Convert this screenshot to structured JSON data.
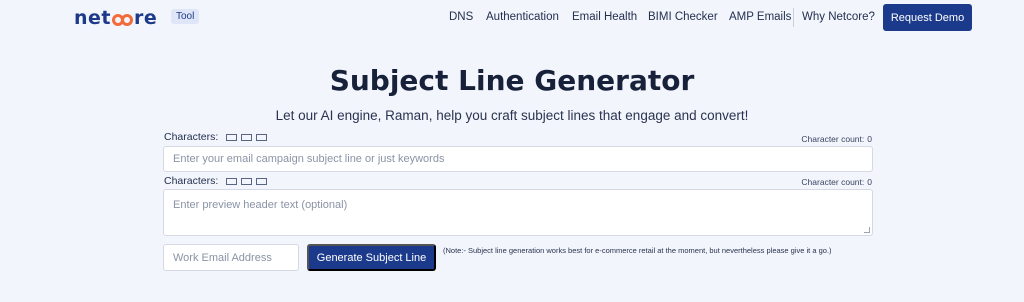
{
  "header": {
    "logo": {
      "prefix": "net",
      "suffix": "re"
    },
    "badge": "Tool",
    "nav": [
      "DNS",
      "Authentication",
      "Email Health",
      "BIMI Checker",
      "AMP Emails",
      "Why Netcore?"
    ],
    "cta": "Request Demo"
  },
  "main": {
    "title": "Subject Line Generator",
    "subtitle": "Let our AI engine, Raman, help you craft subject lines that engage and convert!",
    "subject": {
      "characters_label": "Characters:",
      "count_label": "Character count:",
      "count_value": "0",
      "placeholder": "Enter your email campaign subject line or just keywords",
      "value": ""
    },
    "preview": {
      "characters_label": "Characters:",
      "count_label": "Character count:",
      "count_value": "0",
      "placeholder": "Enter preview header text (optional)",
      "value": ""
    },
    "email_placeholder": "Work Email Address",
    "generate_button": "Generate Subject Line",
    "note": "(Note:- Subject line generation works best for e-commerce retail at the moment, but nevertheless please give it a go.)"
  },
  "colors": {
    "background": "#f3f5fc",
    "primary": "#1b3a8c",
    "logo_accent": "#f26b3a"
  }
}
